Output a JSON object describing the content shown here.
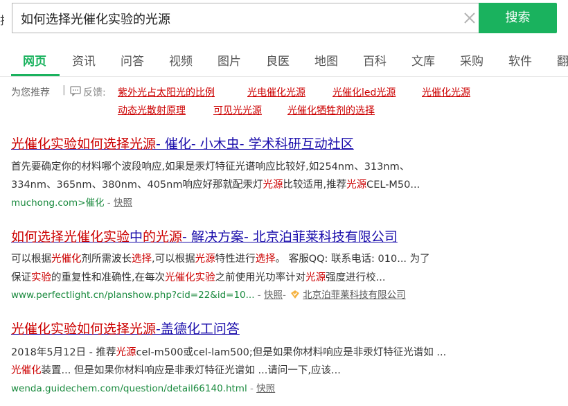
{
  "search": {
    "query": "如何选择光催化实验的光源",
    "button_label": "搜索",
    "left_clip_char": "找"
  },
  "tabs": [
    "网页",
    "资讯",
    "问答",
    "视频",
    "图片",
    "良医",
    "地图",
    "百科",
    "文库",
    "采购",
    "软件",
    "翻"
  ],
  "recommend": {
    "label": "为您推荐",
    "separator": "|",
    "feedback": "反馈:",
    "links": [
      "紫外光占太阳光的比例",
      "光电催化光源",
      "光催化led光源",
      "光催化光源",
      "动态光散射原理",
      "可见光光源",
      "光催化牺牲剂的选择"
    ]
  },
  "results": [
    {
      "title_parts": [
        {
          "t": "光催化实验如何选择光源",
          "red": true
        },
        {
          "t": "- 催化- 小木虫- 学术科研互动社区",
          "red": false
        }
      ],
      "lines": [
        [
          {
            "t": "首先要确定你的材料哪个波段响应,如果是汞灯特征光谱响应比较好,如254nm、313nm、",
            "red": false
          }
        ],
        [
          {
            "t": "334nm、365nm、380nm、405nm响应好那就配汞灯",
            "red": false
          },
          {
            "t": "光源",
            "red": true
          },
          {
            "t": "比较适用,推荐",
            "red": false
          },
          {
            "t": "光源",
            "red": true
          },
          {
            "t": "CEL-M50...",
            "red": false
          }
        ]
      ],
      "url": "muchong.com>催化",
      "snapshot": "快照",
      "company": ""
    },
    {
      "title_parts": [
        {
          "t": "如何选择光催化实验",
          "red": true
        },
        {
          "t": "中",
          "red": false
        },
        {
          "t": "的光源",
          "red": true
        },
        {
          "t": "- 解决方案- 北京泊菲莱科技有限公司",
          "red": false
        }
      ],
      "lines": [
        [
          {
            "t": "可以根据",
            "red": false
          },
          {
            "t": "光催化",
            "red": true
          },
          {
            "t": "剂所需波长",
            "red": false
          },
          {
            "t": "选择",
            "red": true
          },
          {
            "t": ",可以根据",
            "red": false
          },
          {
            "t": "光源",
            "red": true
          },
          {
            "t": "特性进行",
            "red": false
          },
          {
            "t": "选择",
            "red": true
          },
          {
            "t": "。 客服QQ: 联系电话: 010... 为了",
            "red": false
          }
        ],
        [
          {
            "t": "保证",
            "red": false
          },
          {
            "t": "实验",
            "red": true
          },
          {
            "t": "的重复性和准确性,在每次",
            "red": false
          },
          {
            "t": "光催化实验",
            "red": true
          },
          {
            "t": "之前使用光功率计对",
            "red": false
          },
          {
            "t": "光源",
            "red": true
          },
          {
            "t": "强度进行校...",
            "red": false
          }
        ]
      ],
      "url": "www.perfectlight.cn/planshow.php?cid=22&id=10...",
      "snapshot": "快照",
      "company": "北京泊菲莱科技有限公司"
    },
    {
      "title_parts": [
        {
          "t": "光催化实验如何选择光源",
          "red": true
        },
        {
          "t": "-盖德化工问答",
          "red": false
        }
      ],
      "lines": [
        [
          {
            "t": "2018年5月12日 - 推荐",
            "red": false
          },
          {
            "t": "光源",
            "red": true
          },
          {
            "t": "cel-m500或cel-lam500;但是如果你材料响应是非汞灯特征光谱如 ...",
            "red": false
          }
        ],
        [
          {
            "t": "光催化",
            "red": true
          },
          {
            "t": "装置... 但是如果你材料响应是非汞灯特征光谱如 ...请问一下,应该...",
            "red": false
          }
        ]
      ],
      "url": "wenda.guidechem.com/question/detail66140.html",
      "snapshot": "快照",
      "company": ""
    }
  ],
  "colors": {
    "accent": "#1ab25e",
    "link": "#1a0dab",
    "highlight": "#cc0000",
    "url": "#1a8a3e"
  }
}
